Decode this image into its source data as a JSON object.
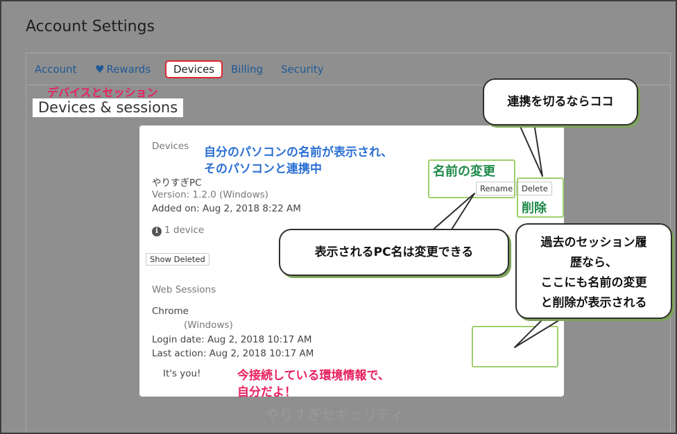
{
  "page": {
    "title": "Account Settings"
  },
  "tabs": [
    {
      "label": "Account"
    },
    {
      "label": "Rewards",
      "icon": "heart-icon"
    },
    {
      "label": "Devices",
      "active": true
    },
    {
      "label": "Billing"
    },
    {
      "label": "Security"
    }
  ],
  "section": {
    "annotation": "デバイスとセッション",
    "heading": "Devices & sessions"
  },
  "devices": {
    "heading": "Devices",
    "item": {
      "name": "やりすぎPC",
      "version": "Version: 1.2.0 (Windows)",
      "added": "Added on: Aug 2, 2018 8:22 AM",
      "rename_label": "Rename",
      "delete_label": "Delete"
    },
    "count": "1 device",
    "show_deleted_label": "Show Deleted"
  },
  "web_sessions": {
    "heading": "Web Sessions",
    "browser": "Chrome",
    "os": "(Windows)",
    "login": "Login date: Aug 2, 2018 10:17 AM",
    "last_action": "Last action: Aug 2, 2018 10:17 AM",
    "current": "It's you!"
  },
  "annotations": {
    "pc_name_line1": "自分のパソコンの名前が表示され、",
    "pc_name_line2": "そのパソコンと連携中",
    "rename": "名前の変更",
    "delete": "削除",
    "env_line1": "今接続している環境情報で、",
    "env_line2": "自分だよ！"
  },
  "bubbles": {
    "disconnect": "連携を切るならココ",
    "pc_name_editable": "表示されるPC名は変更できる",
    "history_line1": "過去のセッション履",
    "history_line2": "歴なら、",
    "history_line3": "ここにも名前の変更",
    "history_line4": "と削除が表示される"
  },
  "watermark": "やりすぎセキュリティ",
  "colors": {
    "link": "#1e5a96",
    "active_tab_border": "#e0262f",
    "note_pink": "#e8205f",
    "note_blue": "#2b6fd3",
    "note_green": "#1e8a4a",
    "highlight_box": "#9fcf6e"
  }
}
